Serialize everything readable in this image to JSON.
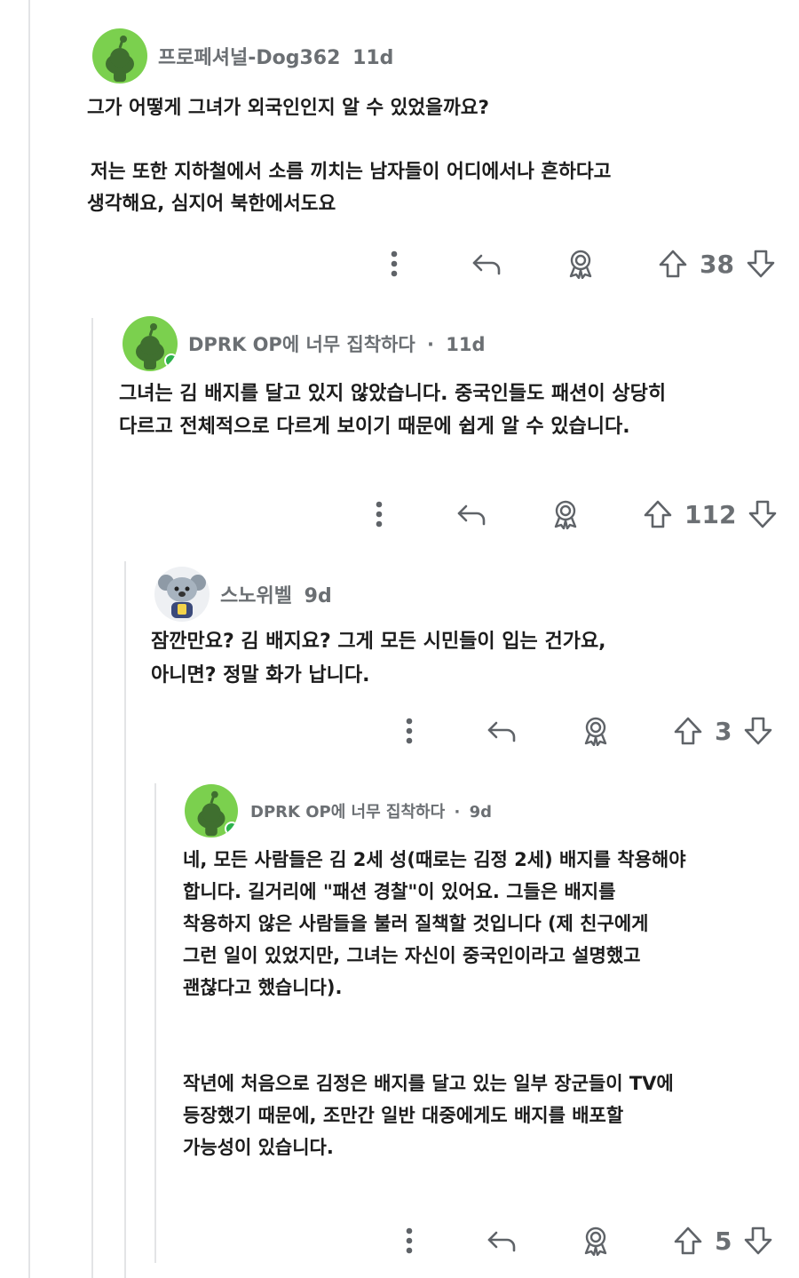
{
  "colors": {
    "avatar_green": "#7bd04e",
    "online_dot": "#2bb24c",
    "meta_text": "#6b6f73",
    "body_text": "#1c1c1c",
    "thread_line": "#e3e4e6"
  },
  "icons": {
    "more": "more-vertical-icon",
    "reply": "reply-arrow-icon",
    "award": "award-icon",
    "upvote": "upvote-arrow-icon",
    "downvote": "downvote-arrow-icon"
  },
  "comments": [
    {
      "author": "프로페셔널-Dog362",
      "age": "11d",
      "separator": "",
      "paragraphs": [
        "그가 어떻게 그녀가 외국인인지 알 수 있었을까요?",
        "",
        "저는 또한 지하철에서 소름 끼치는 남자들이 어디에서나 흔하다고",
        "생각해요, 심지어 북한에서도요"
      ],
      "score": "38"
    },
    {
      "author": "DPRK OP에 너무 집착하다",
      "age": "11d",
      "separator": "·",
      "paragraphs": [
        "그녀는 김 배지를 달고 있지 않았습니다. 중국인들도 패션이 상당히",
        "다르고 전체적으로 다르게 보이기 때문에 쉽게 알 수 있습니다."
      ],
      "score": "112"
    },
    {
      "author": "스노위벨",
      "age": "9d",
      "separator": "",
      "paragraphs": [
        "잠깐만요? 김 배지요? 그게 모든 시민들이 입는 건가요,",
        "아니면? 정말 화가 납니다."
      ],
      "score": "3"
    },
    {
      "author": "DPRK OP에 너무 집착하다",
      "age": "9d",
      "separator": "·",
      "paragraphs": [
        "네, 모든 사람들은 김 2세 성(때로는 김정 2세) 배지를 착용해야",
        "합니다. 길거리에 \"패션 경찰\"이 있어요. 그들은 배지를",
        "착용하지 않은 사람들을 불러 질책할 것입니다 (제 친구에게",
        "그런 일이 있었지만, 그녀는 자신이 중국인이라고 설명했고",
        "괜찮다고 했습니다).",
        "",
        "",
        "작년에 처음으로 김정은 배지를 달고 있는 일부 장군들이 TV에",
        "등장했기 때문에, 조만간 일반 대중에게도 배지를 배포할",
        "가능성이 있습니다."
      ],
      "score": "5"
    }
  ]
}
